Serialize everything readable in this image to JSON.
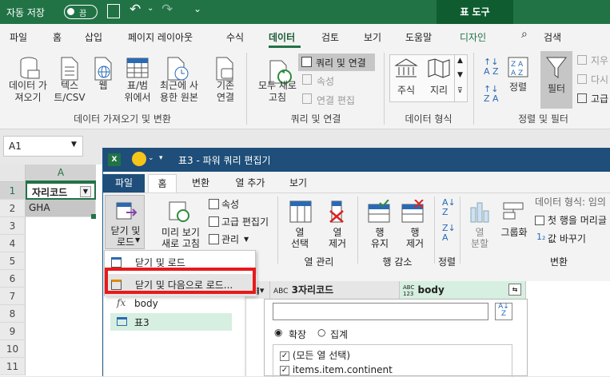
{
  "excel": {
    "titlebar": {
      "autosave_label": "자동 저장",
      "autosave_state": "끔",
      "tool_context": "표 도구"
    },
    "tabs": [
      "파일",
      "홈",
      "삽입",
      "페이지 레이아웃",
      "수식",
      "데이터",
      "검토",
      "보기",
      "도움말",
      "디자인"
    ],
    "search_label": "검색",
    "ribbon": {
      "get_data": "데이터 가\n져오기",
      "text_csv": "텍스\n트/CSV",
      "web": "웹",
      "from_table": "표/범\n위에서",
      "recent_sources": "최근에 사\n용한 원본",
      "existing": "기존\n연결",
      "refresh_all": "모두 새로\n고침",
      "queries_connections": "쿼리 및 연결",
      "properties": "속성",
      "edit_links": "연결 편집",
      "stocks": "주식",
      "geography": "지리",
      "sort": "정렬",
      "filter": "필터",
      "clear": "지우",
      "reapply": "다시",
      "advanced": "고급"
    },
    "groups": {
      "get_transform": "데이터 가져오기 및 변환",
      "queries": "쿼리 및 연결",
      "data_types": "데이터 형식",
      "sort_filter": "정렬 및 필터"
    },
    "name_box": "A1",
    "column": "A",
    "rows": [
      "1",
      "2",
      "3",
      "4",
      "5",
      "6",
      "7",
      "8",
      "9",
      "10",
      "11"
    ],
    "cells": {
      "a1": "자리코드",
      "a2": "GHA"
    }
  },
  "pq": {
    "title": "표3 - 파워 쿼리 편집기",
    "tabs": [
      "파일",
      "홈",
      "변환",
      "열 추가",
      "보기"
    ],
    "ribbon": {
      "close_load": "닫기 및\n로드",
      "preview_refresh": "미리 보기\n새로 고침",
      "properties": "속성",
      "advanced_editor": "고급 편집기",
      "manage": "관리",
      "choose_cols": "열\n선택",
      "remove_cols": "열\n제거",
      "keep_rows": "행\n유지",
      "remove_rows": "행\n제거",
      "split_col": "열\n분할",
      "group_by": "그룹화",
      "data_type": "데이터 형식: 임의",
      "first_row_header": "첫 행을 머리글",
      "replace_values": "값 바꾸기"
    },
    "groups": {
      "manage_cols": "열 관리",
      "reduce_rows": "행 감소",
      "sort": "정렬",
      "transform": "변환"
    },
    "menu": [
      "닫기 및 로드",
      "닫기 및 다음으로 로드..."
    ],
    "queries": [
      "body",
      "표3"
    ],
    "columns": [
      {
        "type": "ABC",
        "name": "3자리코드"
      },
      {
        "type": "ABC\n123",
        "name": "body"
      }
    ],
    "expand_label": "확장",
    "aggregate_label": "집계",
    "expand_items": [
      "(모든 열 선택)",
      "items.item.continent"
    ],
    "highlight_color": "#e8191a"
  }
}
